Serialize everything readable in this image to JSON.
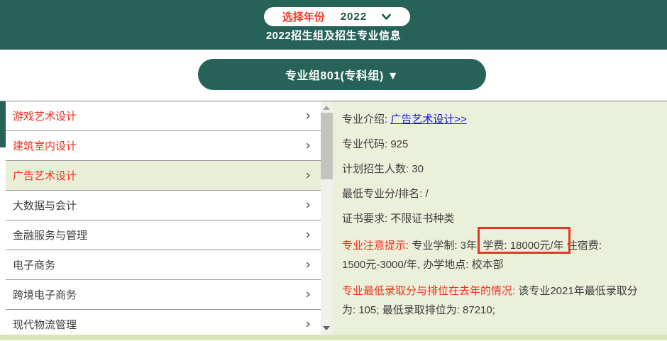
{
  "colors": {
    "teal": "#266257",
    "panel_green": "#ebf0db",
    "selected_green": "#e9eed6",
    "bottom_bar_green": "#d9e6b6",
    "red_text": "#f6301c",
    "annotation_red": "#e23a22",
    "link_blue": "#1414d6"
  },
  "header": {
    "year_label": "选择年份",
    "year_value": "2022",
    "title": "2022招生组及招生专业信息"
  },
  "group_button": {
    "label": "专业组801(专科组) ▼"
  },
  "majors": {
    "chevron": "›",
    "items": [
      {
        "label": "游戏艺术设计",
        "red": true,
        "selected": false
      },
      {
        "label": "建筑室内设计",
        "red": true,
        "selected": false
      },
      {
        "label": "广告艺术设计",
        "red": true,
        "selected": true
      },
      {
        "label": "大数据与会计",
        "red": false,
        "selected": false
      },
      {
        "label": "金融服务与管理",
        "red": false,
        "selected": false
      },
      {
        "label": "电子商务",
        "red": false,
        "selected": false
      },
      {
        "label": "跨境电子商务",
        "red": false,
        "selected": false
      },
      {
        "label": "现代物流管理",
        "red": false,
        "selected": false
      }
    ]
  },
  "details": {
    "intro_label": "专业介绍: ",
    "intro_link": "广告艺术设计>>",
    "code_label": "专业代码: ",
    "code_value": "925",
    "plan_label": "计划招生人数: ",
    "plan_value": "30",
    "min_label": "最低专业分/排名: ",
    "min_value": "/",
    "cert_label": "证书要求: ",
    "cert_value": "不限证书种类",
    "notice_label": "专业注意提示: ",
    "notice_pre": "专业学制: 3年, ",
    "notice_boxed": "学费: 18000元/年",
    "notice_post1": " 住宿费:",
    "notice_post2": "1500元-3000/年, 办学地点: 校本部",
    "history_label": "专业最低录取分与排位在去年的情况: ",
    "history_line1": " 该专业2021年最低录取分",
    "history_line2": "为: 105; 最低录取排位为: 87210;"
  }
}
